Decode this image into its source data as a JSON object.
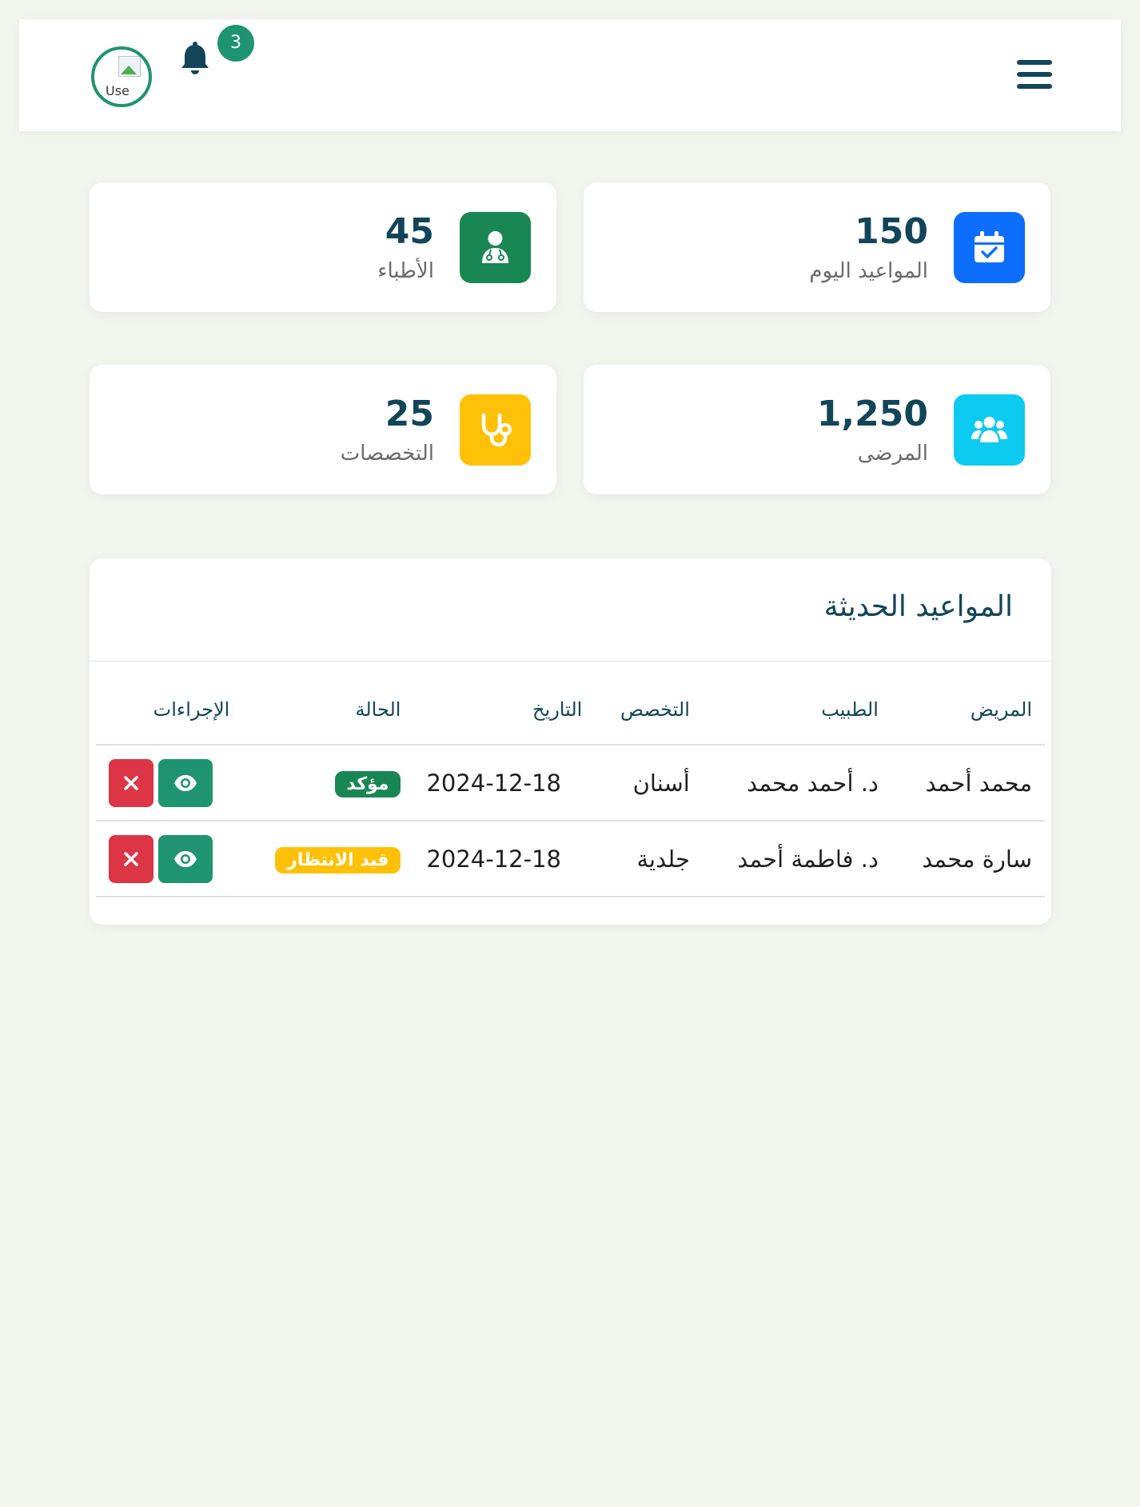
{
  "header": {
    "notification_count": "3",
    "avatar_alt": "Use"
  },
  "stats": [
    {
      "value": "150",
      "label": "المواعيد اليوم",
      "color": "#0d6efd",
      "icon": "calendar-check-icon"
    },
    {
      "value": "45",
      "label": "الأطباء",
      "color": "#198754",
      "icon": "doctor-icon"
    },
    {
      "value": "1,250",
      "label": "المرضى",
      "color": "#0dcaf0",
      "icon": "users-icon"
    },
    {
      "value": "25",
      "label": "التخصصات",
      "color": "#ffc107",
      "icon": "stethoscope-icon"
    }
  ],
  "appointments": {
    "title": "المواعيد الحديثة",
    "columns": [
      "المريض",
      "الطبيب",
      "التخصص",
      "التاريخ",
      "الحالة",
      "الإجراءات"
    ],
    "rows": [
      {
        "patient": "محمد أحمد",
        "doctor": "د. أحمد محمد",
        "specialty": "أسنان",
        "date": "2024-12-18",
        "status": "مؤكد",
        "status_color": "#198754"
      },
      {
        "patient": "سارة محمد",
        "doctor": "د. فاطمة أحمد",
        "specialty": "جلدية",
        "date": "2024-12-18",
        "status": "قيد الانتظار",
        "status_color": "#ffc107"
      }
    ]
  }
}
